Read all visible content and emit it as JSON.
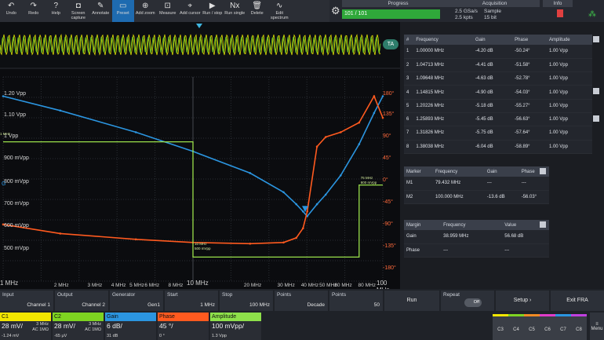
{
  "toolbar": {
    "buttons": [
      {
        "icon": "↶",
        "label": "Undo"
      },
      {
        "icon": "↷",
        "label": "Redo"
      },
      {
        "icon": "?",
        "label": "Help"
      },
      {
        "icon": "◘",
        "label": "Screen capture"
      },
      {
        "icon": "✎",
        "label": "Annotate"
      },
      {
        "icon": "▭",
        "label": "Preset"
      },
      {
        "icon": "⊕",
        "label": "Add zoom"
      },
      {
        "icon": "⊡",
        "label": "Measure"
      },
      {
        "icon": "⌖",
        "label": "Add cursor"
      },
      {
        "icon": "▶",
        "label": "Run / stop"
      },
      {
        "icon": "Nx",
        "label": "Run single"
      },
      {
        "icon": "🗑",
        "label": "Delete"
      },
      {
        "icon": "∿",
        "label": "Edit spectrum"
      }
    ]
  },
  "status": {
    "progress_title": "Progress",
    "progress_value": "101 / 101",
    "progress_fraction": 1.0,
    "acq_title": "Acquisition",
    "acq_rate": "2.5 GSa/s",
    "acq_mode": "Sample",
    "acq_pts": "2.5 kpts",
    "acq_bits": "15 bit",
    "info_title": "Info"
  },
  "strip": {
    "label": "TA",
    "ch_tag": "2"
  },
  "plot": {
    "y_labels": [
      "1.20 Vpp",
      "1.10 Vpp",
      "1 Vpp",
      "900 mVpp",
      "800 mVpp",
      "700 mVpp",
      "600 mVpp",
      "500 mVpp"
    ],
    "phase_labels": [
      "180°",
      "135°",
      "90°",
      "45°",
      "0°",
      "-45°",
      "-90°",
      "-135°",
      "-180°"
    ],
    "x_labels": [
      "1 MHz",
      "2 MHz",
      "3 MHz",
      "4 MHz",
      "5 MHz",
      "6 MHz",
      "8 MHz",
      "10 MHz",
      "20 MHz",
      "30 MHz",
      "40 MHz",
      "50 MHz",
      "60 MHz",
      "80 MHz",
      "100 MHz"
    ],
    "marker1_label": "10 MHz",
    "marker1_sub": "500 mVpp",
    "marker2_label": "75 MHz",
    "marker2_sub": "800 mVpp",
    "left_tag_1": "1 MHz",
    "left_tag_2": "G"
  },
  "results": {
    "headers": [
      "#",
      "Frequency",
      "Gain",
      "Phase",
      "Amplitude"
    ],
    "rows": [
      [
        "1",
        "1.00000 MHz",
        "-4.20 dB",
        "-50.24°",
        "1.00 Vpp"
      ],
      [
        "2",
        "1.04713 MHz",
        "-4.41 dB",
        "-51.58°",
        "1.00 Vpp"
      ],
      [
        "3",
        "1.09648 MHz",
        "-4.63 dB",
        "-52.78°",
        "1.00 Vpp"
      ],
      [
        "4",
        "1.14815 MHz",
        "-4.90 dB",
        "-54.03°",
        "1.00 Vpp"
      ],
      [
        "5",
        "1.20226 MHz",
        "-5.18 dB",
        "-55.27°",
        "1.00 Vpp"
      ],
      [
        "6",
        "1.25893 MHz",
        "-5.45 dB",
        "-56.63°",
        "1.00 Vpp"
      ],
      [
        "7",
        "1.31826 MHz",
        "-5.75 dB",
        "-57.64°",
        "1.00 Vpp"
      ],
      [
        "8",
        "1.38038 MHz",
        "-6.04 dB",
        "-58.89°",
        "1.00 Vpp"
      ]
    ]
  },
  "markers": {
    "headers": [
      "Marker",
      "Frequency",
      "Gain",
      "Phase"
    ],
    "rows": [
      [
        "M1",
        "79.432 MHz",
        "---",
        "---"
      ],
      [
        "M2",
        "100.000 MHz",
        "-13.6 dB",
        "-56.03°"
      ]
    ]
  },
  "margin": {
    "headers": [
      "Margin",
      "Frequency",
      "Value"
    ],
    "rows": [
      [
        "Gain",
        "38.959 MHz",
        "56.68 dB"
      ],
      [
        "Phase",
        "---",
        "---"
      ]
    ]
  },
  "settings": {
    "input_label": "Input",
    "input_value": "Channel 1",
    "output_label": "Output",
    "output_value": "Channel 2",
    "generator_label": "Generator",
    "generator_value": "Gen1",
    "start_label": "Start",
    "start_value": "1 MHz",
    "stop_label": "Stop",
    "stop_value": "100 MHz",
    "points_label": "Points",
    "points_value": "Decade",
    "points2_label": "Points",
    "points2_value": "50",
    "run_label": "Run",
    "repeat_label": "Repeat",
    "repeat_value": "Off",
    "setup_label": "Setup",
    "exit_label": "Exit FRA",
    "menu_label": "Menu"
  },
  "channels": [
    {
      "name": "C1",
      "value": "28 mV/",
      "freq": "3 MHz",
      "coupling": "AC 1MΩ",
      "offset": "-1.24 mV",
      "color": "#f2e600"
    },
    {
      "name": "C2",
      "value": "28 mV/",
      "freq": "3 MHz",
      "coupling": "AC 1MΩ",
      "offset": "-65 μV",
      "color": "#7ed321"
    },
    {
      "name": "Gain",
      "value": "6 dB/",
      "freq": "",
      "coupling": "",
      "offset": "31 dB",
      "color": "#2b95e0"
    },
    {
      "name": "Phase",
      "value": "45 °/",
      "freq": "",
      "coupling": "",
      "offset": "0 °",
      "color": "#ff5a1f"
    },
    {
      "name": "Amplitude",
      "value": "100 mVpp/",
      "freq": "",
      "coupling": "",
      "offset": "1.3 Vpp",
      "color": "#8ee04a"
    }
  ],
  "channel_tabs": [
    "C3",
    "C4",
    "C5",
    "C6",
    "C7",
    "C8"
  ],
  "chart_data": {
    "type": "line",
    "xlabel": "",
    "ylabel": "",
    "x_scale": "log",
    "xlim": [
      1,
      100
    ],
    "series": [
      {
        "name": "Gain",
        "color": "#2b95e0",
        "x": [
          1,
          2,
          5,
          10,
          20,
          30,
          35,
          38,
          40,
          45,
          50,
          60,
          75,
          90,
          100
        ],
        "y": [
          1.17,
          1.11,
          1.02,
          0.94,
          0.85,
          0.77,
          0.72,
          0.69,
          0.67,
          0.72,
          0.76,
          0.84,
          0.97,
          1.1,
          1.17
        ]
      },
      {
        "name": "Phase",
        "color": "#ff5a1f",
        "x": [
          1,
          2,
          5,
          10,
          20,
          30,
          35,
          38,
          40,
          45,
          50,
          60,
          75,
          90,
          100
        ],
        "y": [
          0.636,
          0.598,
          0.574,
          0.561,
          0.556,
          0.561,
          0.58,
          0.62,
          0.69,
          0.96,
          1.0,
          1.02,
          1.06,
          1.17,
          1.08
        ]
      },
      {
        "name": "Amplitude",
        "color": "#9ae04a",
        "x": [
          1,
          10,
          10,
          75,
          75,
          100
        ],
        "y": [
          0.98,
          0.98,
          0.5,
          0.5,
          0.8,
          0.8
        ]
      }
    ]
  }
}
